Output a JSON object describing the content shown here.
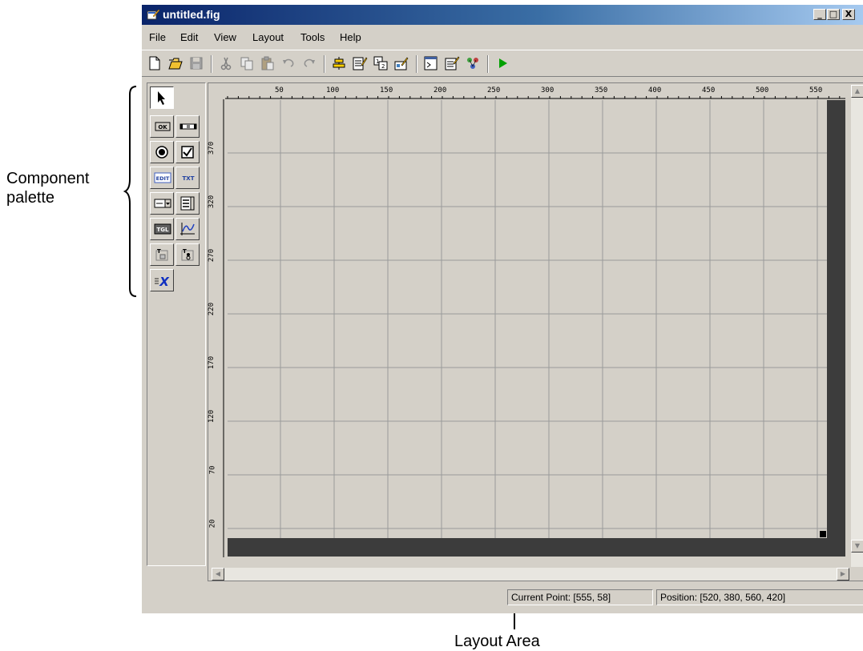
{
  "window": {
    "title": "untitled.fig",
    "controls": {
      "minimize": "_",
      "maximize": "□",
      "close": "X"
    }
  },
  "menubar": {
    "items": [
      "File",
      "Edit",
      "View",
      "Layout",
      "Tools",
      "Help"
    ]
  },
  "toolbar": {
    "icons": [
      "new-figure-icon",
      "open-icon",
      "save-icon",
      "cut-icon",
      "copy-icon",
      "paste-icon",
      "undo-icon",
      "redo-icon",
      "align-objects-icon",
      "menu-editor-icon",
      "tab-order-editor-icon",
      "toolbar-editor-icon",
      "editor-icon",
      "property-inspector-icon",
      "object-browser-icon",
      "run-figure-icon"
    ]
  },
  "palette": {
    "tools": [
      "select-tool",
      "push-button-tool",
      "slider-tool",
      "radio-button-tool",
      "checkbox-tool",
      "edit-text-tool",
      "static-text-tool",
      "popup-menu-tool",
      "listbox-tool",
      "toggle-button-tool",
      "axes-tool",
      "panel-tool",
      "button-group-tool",
      "activex-control-tool"
    ],
    "labels": {
      "ok": "OK",
      "edit": "EDIT",
      "txt": "TXT",
      "tgl": "TGL"
    }
  },
  "layout": {
    "hruler_labels": [
      "50",
      "100",
      "150",
      "200",
      "250",
      "300",
      "350",
      "400",
      "450",
      "500",
      "550"
    ],
    "vruler_labels": [
      "370",
      "320",
      "270",
      "220",
      "170",
      "120",
      "70",
      "20"
    ]
  },
  "statusbar": {
    "current_point": "Current Point:  [555, 58]",
    "position": "Position: [520, 380, 560, 420]"
  },
  "annotations": {
    "palette_line1": "Component",
    "palette_line2": "palette",
    "layout_area": "Layout Area"
  },
  "colors": {
    "face": "#d4d0c8",
    "grid": "#9a9a9a",
    "border_dark": "#3c3c3c",
    "title_start": "#0a246a",
    "title_end": "#a6caf0"
  }
}
